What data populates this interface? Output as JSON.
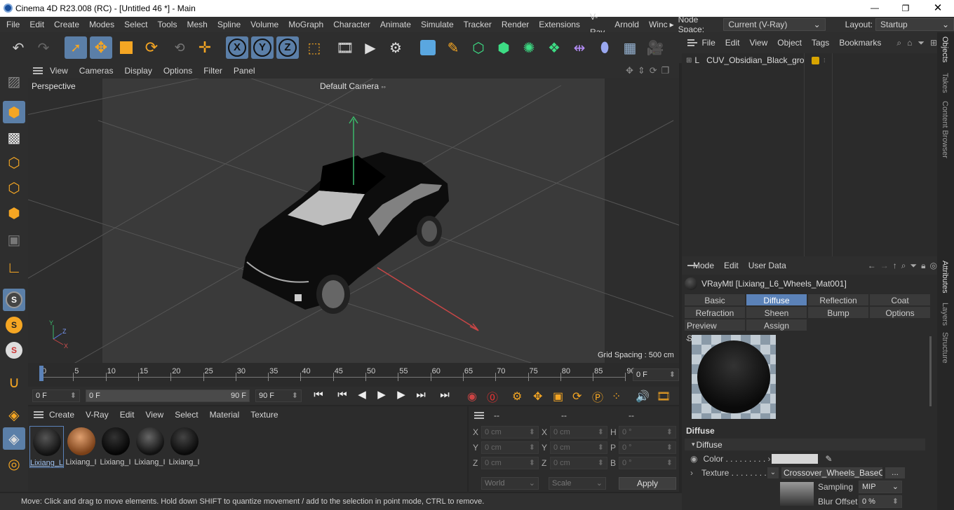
{
  "window": {
    "title": "Cinema 4D R23.008 (RC) - [Untitled 46 *] - Main"
  },
  "menu": {
    "items": [
      "File",
      "Edit",
      "Create",
      "Modes",
      "Select",
      "Tools",
      "Mesh",
      "Spline",
      "Volume",
      "MoGraph",
      "Character",
      "Animate",
      "Simulate",
      "Tracker",
      "Render",
      "Extensions",
      "V-Ray",
      "Arnold",
      "Winc"
    ],
    "more_arrow": "▸",
    "node_space_label": "Node Space:",
    "node_space_value": "Current (V-Ray)",
    "layout_label": "Layout:",
    "layout_value": "Startup"
  },
  "viewport": {
    "menu": [
      "View",
      "Cameras",
      "Display",
      "Options",
      "Filter",
      "Panel"
    ],
    "label": "Perspective",
    "camera": "Default Camera",
    "grid_spacing": "Grid Spacing : 500 cm",
    "axis_x": "X",
    "axis_y": "Y",
    "axis_z": "Z"
  },
  "timeline": {
    "ticks": [
      "0",
      "5",
      "10",
      "15",
      "20",
      "25",
      "30",
      "35",
      "40",
      "45",
      "50",
      "55",
      "60",
      "65",
      "70",
      "75",
      "80",
      "85",
      "90"
    ],
    "current_frame": "0 F"
  },
  "transport": {
    "start": "0 F",
    "range_start": "0 F",
    "range_end": "90 F",
    "end": "90 F"
  },
  "material_manager": {
    "menu": [
      "Create",
      "V-Ray",
      "Edit",
      "View",
      "Select",
      "Material",
      "Texture"
    ],
    "materials": [
      "Lixiang_L",
      "Lixiang_I",
      "Lixiang_I",
      "Lixiang_I",
      "Lixiang_I"
    ]
  },
  "coordinates": {
    "header": [
      "--",
      "--",
      "--"
    ],
    "rows": [
      {
        "a": "X",
        "av": "0 cm",
        "b": "X",
        "bv": "0 cm",
        "c": "H",
        "cv": "0 °"
      },
      {
        "a": "Y",
        "av": "0 cm",
        "b": "Y",
        "bv": "0 cm",
        "c": "P",
        "cv": "0 °"
      },
      {
        "a": "Z",
        "av": "0 cm",
        "b": "Z",
        "bv": "0 cm",
        "c": "B",
        "cv": "0 °"
      }
    ],
    "mode_world": "World",
    "mode_scale": "Scale",
    "apply": "Apply"
  },
  "objects": {
    "menu": [
      "File",
      "Edit",
      "View",
      "Object",
      "Tags",
      "Bookmarks"
    ],
    "items": [
      {
        "name": "CUV_Obsidian_Black_group"
      }
    ]
  },
  "attributes": {
    "menu": [
      "Mode",
      "Edit",
      "User Data"
    ],
    "material_name": "VRayMtl [Lixiang_L6_Wheels_Mat001]",
    "tabs_row1": [
      "Basic",
      "Diffuse",
      "Reflection",
      "Coat"
    ],
    "tabs_row2": [
      "Refraction",
      "Sheen",
      "Bump",
      "Options"
    ],
    "tabs_row3": [
      "Preview Settings",
      "Assign"
    ],
    "active_tab": "Diffuse",
    "section": "Diffuse",
    "group": "Diffuse",
    "color_label": "Color . . . . . . . . .",
    "texture_label": "Texture . . . . . . . .",
    "texture_value": "Crossover_Wheels_BaseColo",
    "texture_more": "...",
    "sampling_label": "Sampling",
    "sampling_value": "MIP",
    "blur_label": "Blur Offset",
    "blur_value": "0 %"
  },
  "side_tabs": [
    "Objects",
    "Takes",
    "Content Browser",
    "Attributes",
    "Layers",
    "Structure"
  ],
  "status": {
    "text": "Move: Click and drag to move elements. Hold down SHIFT to quantize movement / add to the selection in point mode, CTRL to remove."
  },
  "colors": {
    "accent": "#5b82b8",
    "orange": "#f5a623",
    "bg": "#2b2b2b"
  }
}
